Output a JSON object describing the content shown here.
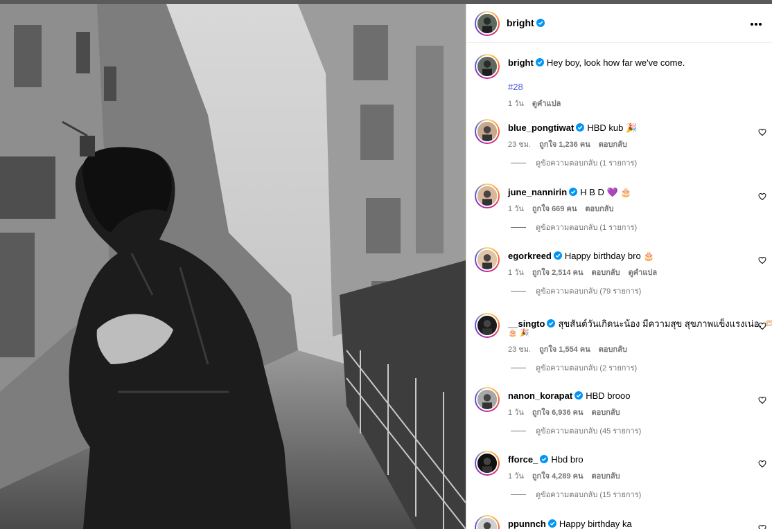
{
  "post": {
    "author": "bright",
    "caption": "Hey boy, look how far we've come.",
    "hashtag": "#28",
    "time": "1 วัน",
    "translate_label": "ดูคำแปล"
  },
  "comments": [
    {
      "user": "blue_pongtiwat",
      "text": "HBD kub 🎉",
      "time": "23 ชม.",
      "likes": "ถูกใจ 1,236 คน",
      "reply": "ตอบกลับ",
      "translate": "",
      "replies": "ดูข้อความตอบกลับ (1 รายการ)"
    },
    {
      "user": "june_nannirin",
      "text": "H B D 💜 🎂",
      "time": "1 วัน",
      "likes": "ถูกใจ 669 คน",
      "reply": "ตอบกลับ",
      "translate": "",
      "replies": "ดูข้อความตอบกลับ (1 รายการ)"
    },
    {
      "user": "egorkreed",
      "text": "Happy birthday bro 🎂",
      "time": "1 วัน",
      "likes": "ถูกใจ 2,514 คน",
      "reply": "ตอบกลับ",
      "translate": "ดูคำแปล",
      "replies": "ดูข้อความตอบกลับ (79 รายการ)"
    },
    {
      "user": "__singto",
      "text": "สุขสันต์วันเกิดนะน้อง มีความสุข สุขภาพแข็งแรงเน่อ. 🫶🏻",
      "text2": "🎂 🎉",
      "time": "23 ชม.",
      "likes": "ถูกใจ 1,554 คน",
      "reply": "ตอบกลับ",
      "translate": "",
      "replies": "ดูข้อความตอบกลับ (2 รายการ)"
    },
    {
      "user": "nanon_korapat",
      "text": "HBD brooo",
      "time": "1 วัน",
      "likes": "ถูกใจ 6,936 คน",
      "reply": "ตอบกลับ",
      "translate": "",
      "replies": "ดูข้อความตอบกลับ (45 รายการ)"
    },
    {
      "user": "fforce_",
      "text": "Hbd bro",
      "time": "1 วัน",
      "likes": "ถูกใจ 4,289 คน",
      "reply": "ตอบกลับ",
      "translate": "",
      "replies": "ดูข้อความตอบกลับ (15 รายการ)"
    },
    {
      "user": "ppunnch",
      "text": "Happy birthday ka",
      "time": "",
      "likes": "",
      "reply": "",
      "translate": "",
      "replies": ""
    }
  ],
  "icons": {
    "verified": "verified-badge-icon",
    "more": "more-options-icon",
    "like": "heart-icon"
  },
  "colors": {
    "verified": "#0095f6",
    "hashtag": "#4f5bd5",
    "meta": "#737373"
  }
}
